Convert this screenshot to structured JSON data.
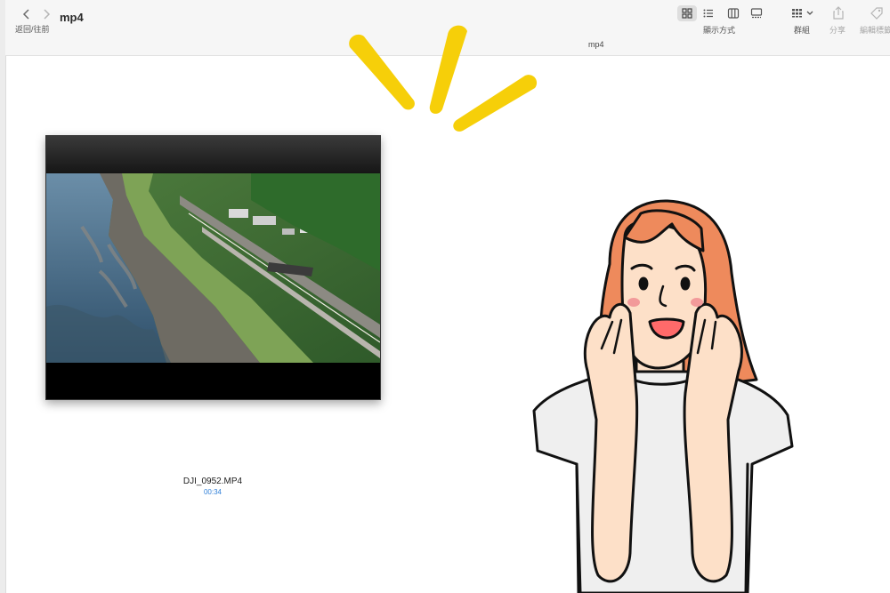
{
  "window": {
    "title": "mp4",
    "path_title": "mp4"
  },
  "toolbar": {
    "nav_label": "返回/往前",
    "view_label": "顯示方式",
    "group_label": "群組",
    "share_label": "分享",
    "tags_label": "編輯標籤"
  },
  "file": {
    "name": "DJI_0952.MP4",
    "duration": "00:34"
  },
  "colors": {
    "duration_text": "#2f7fd8",
    "burst": "#f6cf09",
    "hair": "#ee8a5c",
    "skin": "#fde0c8"
  }
}
